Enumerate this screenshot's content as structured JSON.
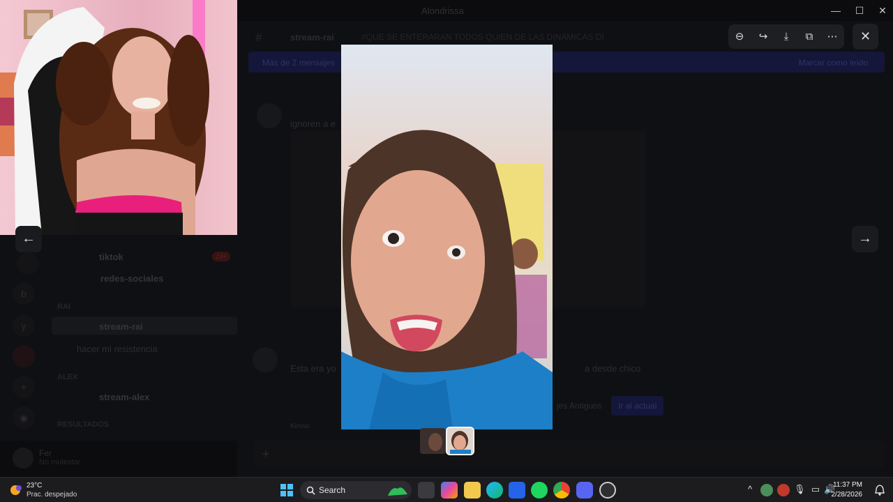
{
  "window": {
    "title": "Alondrissa",
    "min": "—",
    "max": "☐",
    "close": "✕"
  },
  "channel": {
    "name": "stream-rai",
    "topic": "#QUE SE ENTERARAN TODOS QUIEN DE LAS DINAMICAS DI",
    "banner": "Más de 2 mensajes",
    "mark_read": "Marcar como leído"
  },
  "sidebar": {
    "channels": [
      {
        "label": "tiktok",
        "badge": "24+"
      },
      {
        "label": "redes-sociales"
      },
      {
        "label": "stream-rai"
      },
      {
        "label": "hacer mi resistencia"
      },
      {
        "label": "stream-alex"
      }
    ],
    "categories": [
      "RAI",
      "ALEX",
      "RESULTADOS"
    ],
    "server_letters": [
      "b",
      "y"
    ],
    "user": {
      "name": "Fer",
      "status": "No molestar"
    }
  },
  "chat": {
    "msg1_line": "ignoren a e",
    "msg2_line": "Esta era yo",
    "msg2_tail": "a desde chico",
    "chip_old": "jes Antiguos",
    "chip_now": "Ir al actual",
    "footer": "Kirsso"
  },
  "viewer": {
    "toolbar": {
      "zoom": "⊖",
      "forward": "↪",
      "download": "⤓",
      "open": "⧉",
      "more": "⋯"
    },
    "close": "✕",
    "prev": "←",
    "next": "→"
  },
  "taskbar": {
    "weather": {
      "temp": "23°C",
      "condition": "Prac. despejado"
    },
    "search_label": "Search",
    "tray": {
      "caret": "^",
      "mic": "🎙",
      "net": "▭",
      "vol": "🔊"
    },
    "time": "11:37 PM",
    "date": "2/28/2026"
  }
}
